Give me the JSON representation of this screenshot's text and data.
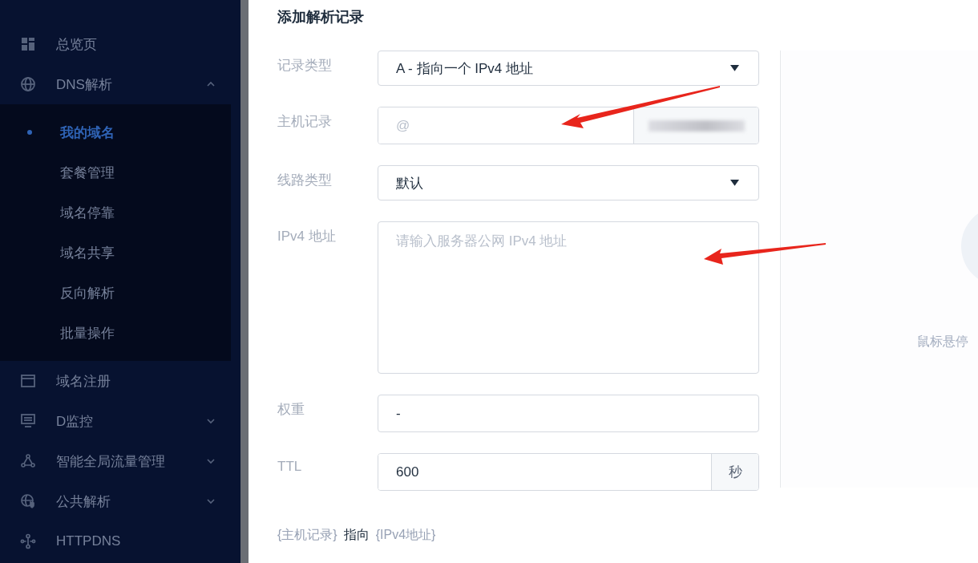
{
  "sidebar": {
    "items": [
      {
        "label": "总览页"
      },
      {
        "label": "DNS解析",
        "expanded": true,
        "children": [
          {
            "label": "我的域名",
            "selected": true
          },
          {
            "label": "套餐管理",
            "selected": false
          },
          {
            "label": "域名停靠",
            "selected": false
          },
          {
            "label": "域名共享",
            "selected": false
          },
          {
            "label": "反向解析",
            "selected": false
          },
          {
            "label": "批量操作",
            "selected": false
          }
        ]
      },
      {
        "label": "域名注册"
      },
      {
        "label": "D监控",
        "expanded": false
      },
      {
        "label": "智能全局流量管理",
        "expanded": false
      },
      {
        "label": "公共解析",
        "expanded": false
      },
      {
        "label": "HTTPDNS"
      }
    ]
  },
  "form": {
    "title": "添加解析记录",
    "fields": [
      {
        "kind": "select",
        "label": "记录类型",
        "value": "A - 指向一个 IPv4 地址"
      },
      {
        "kind": "masked",
        "label": "主机记录",
        "placeholder": "@"
      },
      {
        "kind": "select",
        "label": "线路类型",
        "value": "默认"
      },
      {
        "kind": "textarea",
        "label": "IPv4 地址",
        "placeholder": "请输入服务器公网 IPv4 地址"
      },
      {
        "kind": "input",
        "label": "权重",
        "value": "-"
      },
      {
        "kind": "unit",
        "label": "TTL",
        "value": "600",
        "unit": "秒"
      }
    ]
  },
  "preview": {
    "hint": "鼠标悬停"
  },
  "footer": {
    "host": "{主机记录}",
    "verb": "指向",
    "target": "{IPv4地址}"
  }
}
